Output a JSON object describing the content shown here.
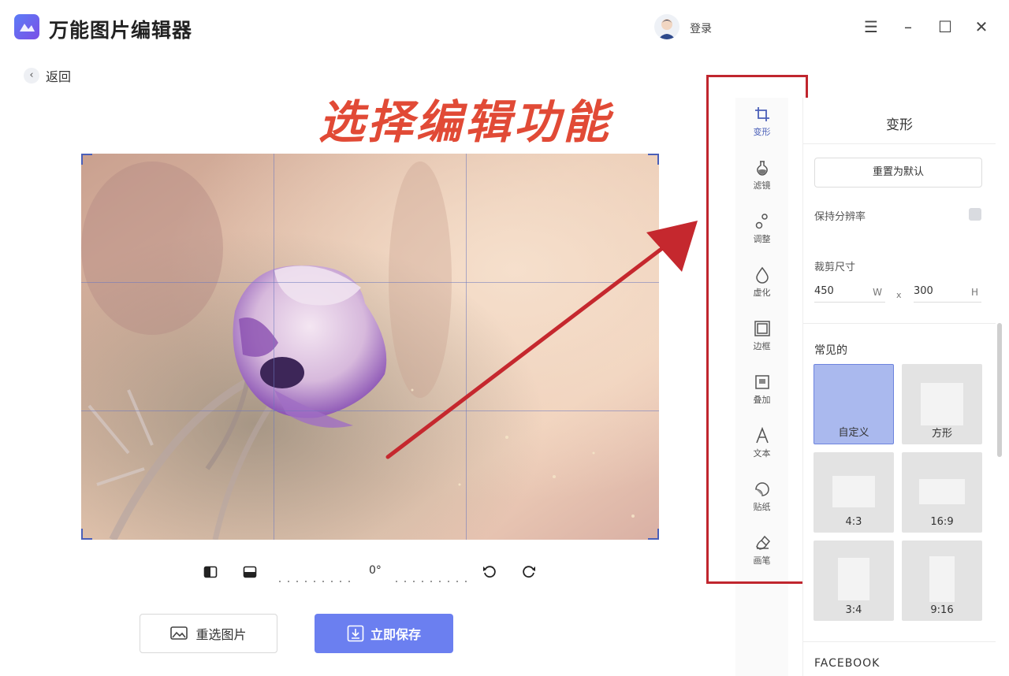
{
  "app": {
    "title": "万能图片编辑器",
    "login": "登录"
  },
  "nav": {
    "back": "返回"
  },
  "annotation": "选择编辑功能",
  "rotate": {
    "angle": "0°"
  },
  "actions": {
    "reselect": "重选图片",
    "save": "立即保存"
  },
  "toolbar": {
    "items": [
      {
        "label": "变形",
        "icon": "crop-icon"
      },
      {
        "label": "滤镜",
        "icon": "filter-icon"
      },
      {
        "label": "调整",
        "icon": "adjust-icon"
      },
      {
        "label": "虚化",
        "icon": "blur-icon"
      },
      {
        "label": "边框",
        "icon": "frame-icon"
      },
      {
        "label": "叠加",
        "icon": "overlay-icon"
      },
      {
        "label": "文本",
        "icon": "text-icon"
      },
      {
        "label": "贴纸",
        "icon": "sticker-icon"
      },
      {
        "label": "画笔",
        "icon": "brush-icon"
      }
    ]
  },
  "panel": {
    "title": "变形",
    "reset": "重置为默认",
    "keep_ratio": "保持分辨率",
    "crop_size": "裁剪尺寸",
    "width": "450",
    "width_unit": "W",
    "times": "x",
    "height": "300",
    "height_unit": "H",
    "common": "常见的",
    "presets": [
      "自定义",
      "方形",
      "4:3",
      "16:9",
      "3:4",
      "9:16"
    ],
    "section_facebook": "FACEBOOK"
  },
  "colors": {
    "accent": "#6b7ff0",
    "highlight_box": "#c0262e",
    "annotation": "#e14a36"
  }
}
